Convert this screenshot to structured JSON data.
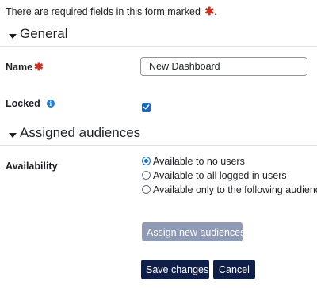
{
  "notice": {
    "text": "There are required fields in this form marked",
    "required_marker": "✱",
    "trailing": "."
  },
  "sections": {
    "general": {
      "title": "General",
      "icon": "chevron-down-icon"
    },
    "audiences": {
      "title": "Assigned audiences",
      "icon": "chevron-down-icon"
    }
  },
  "fields": {
    "name": {
      "label": "Name",
      "required_marker": "✱",
      "value": "New Dashboard"
    },
    "locked": {
      "label": "Locked",
      "info_icon_glyph": "i",
      "checked": true
    },
    "availability": {
      "label": "Availability",
      "options": [
        {
          "label": "Available to no users",
          "checked": true
        },
        {
          "label": "Available to all logged in users",
          "checked": false
        },
        {
          "label": "Available only to the following audiences",
          "checked": false
        }
      ]
    }
  },
  "buttons": {
    "assign": "Assign new audiences",
    "save": "Save changes",
    "cancel": "Cancel"
  },
  "colors": {
    "required": "#ca3120",
    "primary": "#0f1f47",
    "disabled_button": "#8f9bb4",
    "checkbox": "#0f6cbf",
    "info_icon": "#1f7bd4"
  }
}
